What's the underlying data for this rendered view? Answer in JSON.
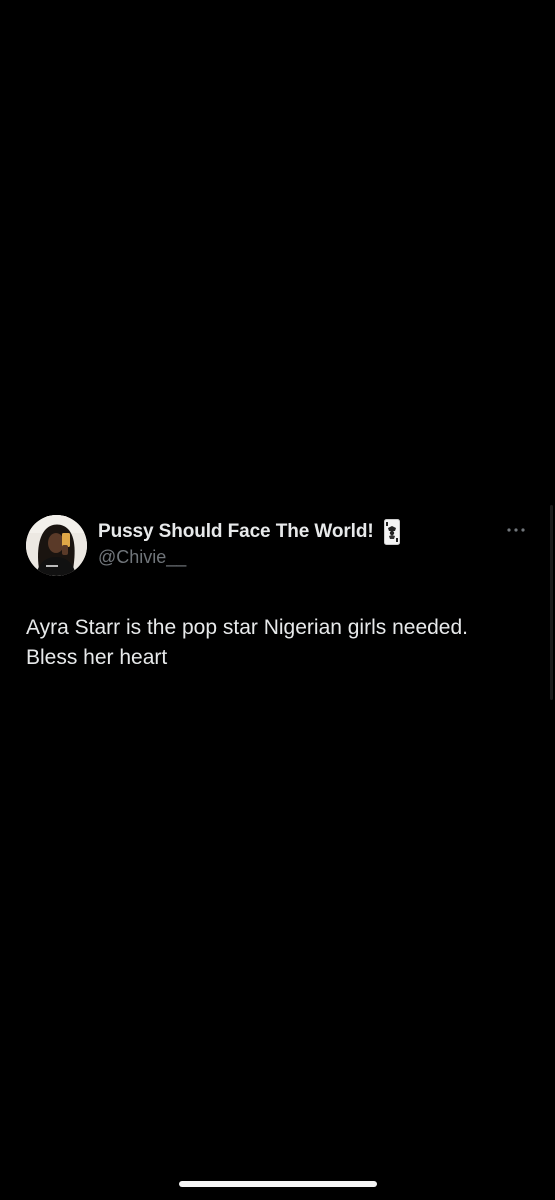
{
  "tweet": {
    "display_name": "Pussy Should Face The World!",
    "badge_icon": "playing-card-joker-icon",
    "handle": "@Chivie__",
    "text_line1": "Ayra Starr is the pop star Nigerian girls needed.",
    "text_line2": "Bless her heart",
    "more_icon": "more-horizontal-icon",
    "avatar_icon": "profile-photo-avatar"
  },
  "colors": {
    "background": "#000000",
    "primary_text": "#e7e9ea",
    "secondary_text": "#71767b"
  }
}
